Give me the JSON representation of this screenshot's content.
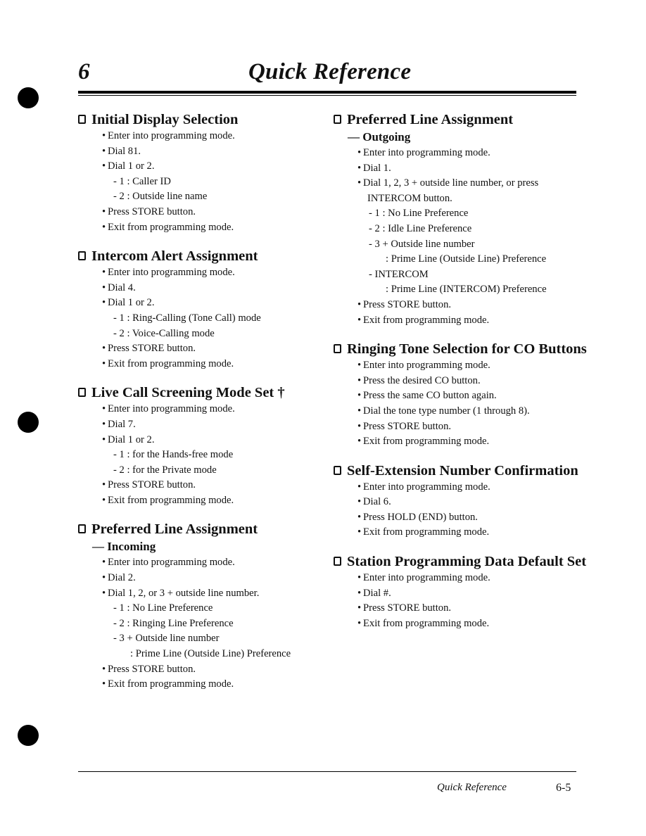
{
  "header": {
    "chapter_number": "6",
    "chapter_title": "Quick Reference"
  },
  "footer": {
    "title": "Quick Reference",
    "page_number": "6-5"
  },
  "left_column": [
    {
      "title": "Initial Display Selection",
      "steps": [
        {
          "type": "bullet",
          "text": "Enter into programming mode."
        },
        {
          "type": "bullet",
          "text": "Dial 81."
        },
        {
          "type": "bullet",
          "text": "Dial 1 or 2."
        },
        {
          "type": "dash",
          "text": "- 1 : Caller ID"
        },
        {
          "type": "dash",
          "text": "- 2 : Outside line name"
        },
        {
          "type": "bullet",
          "text": "Press STORE button."
        },
        {
          "type": "bullet",
          "text": "Exit from programming mode."
        }
      ]
    },
    {
      "title": "Intercom Alert Assignment",
      "steps": [
        {
          "type": "bullet",
          "text": "Enter into programming mode."
        },
        {
          "type": "bullet",
          "text": "Dial 4."
        },
        {
          "type": "bullet",
          "text": "Dial 1 or 2."
        },
        {
          "type": "dash",
          "text": "- 1 : Ring-Calling (Tone Call) mode"
        },
        {
          "type": "dash",
          "text": "- 2 : Voice-Calling mode"
        },
        {
          "type": "bullet",
          "text": "Press STORE button."
        },
        {
          "type": "bullet",
          "text": "Exit from programming mode."
        }
      ]
    },
    {
      "title": "Live Call Screening Mode Set †",
      "steps": [
        {
          "type": "bullet",
          "text": "Enter into programming mode."
        },
        {
          "type": "bullet",
          "text": "Dial 7."
        },
        {
          "type": "bullet",
          "text": "Dial 1 or 2."
        },
        {
          "type": "dash",
          "text": "- 1 : for the Hands-free mode"
        },
        {
          "type": "dash",
          "text": "- 2 : for the Private mode"
        },
        {
          "type": "bullet",
          "text": "Press STORE button."
        },
        {
          "type": "bullet",
          "text": "Exit from programming mode."
        }
      ]
    },
    {
      "title": "Preferred Line Assignment",
      "subtitle": "— Incoming",
      "steps": [
        {
          "type": "bullet",
          "text": "Enter into programming mode."
        },
        {
          "type": "bullet",
          "text": "Dial 2."
        },
        {
          "type": "bullet",
          "text": "Dial 1, 2, or 3 + outside line number."
        },
        {
          "type": "dash",
          "text": "- 1 : No Line Preference"
        },
        {
          "type": "dash",
          "text": "- 2 : Ringing Line Preference"
        },
        {
          "type": "dash",
          "text": "- 3 + Outside line number"
        },
        {
          "type": "cont",
          "text": ": Prime Line (Outside Line) Preference"
        },
        {
          "type": "bullet",
          "text": "Press STORE button."
        },
        {
          "type": "bullet",
          "text": "Exit from programming mode."
        }
      ]
    }
  ],
  "right_column": [
    {
      "title": "Preferred Line Assignment",
      "subtitle": "— Outgoing",
      "steps": [
        {
          "type": "bullet",
          "text": "Enter into programming mode."
        },
        {
          "type": "bullet",
          "text": "Dial 1."
        },
        {
          "type": "bullet",
          "text": "Dial 1, 2, 3 + outside line number, or press"
        },
        {
          "type": "wrap",
          "text": "INTERCOM button."
        },
        {
          "type": "dash",
          "text": "- 1 : No Line Preference"
        },
        {
          "type": "dash",
          "text": "- 2 : Idle Line Preference"
        },
        {
          "type": "dash",
          "text": "- 3 + Outside line number"
        },
        {
          "type": "cont",
          "text": ": Prime Line (Outside Line) Preference"
        },
        {
          "type": "dash",
          "text": "- INTERCOM"
        },
        {
          "type": "cont",
          "text": ": Prime Line (INTERCOM) Preference"
        },
        {
          "type": "bullet",
          "text": "Press STORE button."
        },
        {
          "type": "bullet",
          "text": "Exit from programming mode."
        }
      ]
    },
    {
      "title": "Ringing Tone Selection for CO Buttons",
      "steps": [
        {
          "type": "bullet",
          "text": "Enter into programming mode."
        },
        {
          "type": "bullet",
          "text": "Press the desired CO button."
        },
        {
          "type": "bullet",
          "text": "Press the same CO button again."
        },
        {
          "type": "bullet",
          "text": "Dial the tone type number (1 through 8)."
        },
        {
          "type": "bullet",
          "text": "Press STORE button."
        },
        {
          "type": "bullet",
          "text": "Exit from programming mode."
        }
      ]
    },
    {
      "title": "Self-Extension Number Confirmation",
      "steps": [
        {
          "type": "bullet",
          "text": "Enter into programming mode."
        },
        {
          "type": "bullet",
          "text": "Dial 6."
        },
        {
          "type": "bullet",
          "text": "Press HOLD (END) button."
        },
        {
          "type": "bullet",
          "text": "Exit from programming mode."
        }
      ]
    },
    {
      "title": "Station Programming Data Default Set",
      "steps": [
        {
          "type": "bullet",
          "text": "Enter into programming mode."
        },
        {
          "type": "bullet",
          "text": "Dial #."
        },
        {
          "type": "bullet",
          "text": "Press STORE button."
        },
        {
          "type": "bullet",
          "text": "Exit from programming mode."
        }
      ]
    }
  ]
}
